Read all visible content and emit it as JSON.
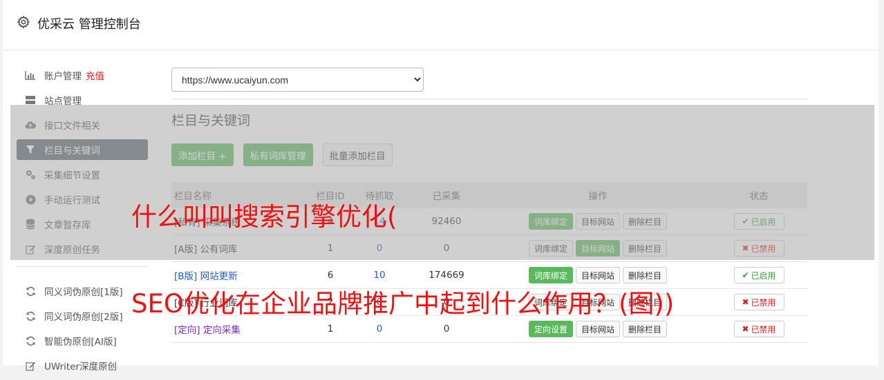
{
  "header": {
    "title": "优采云 管理控制台",
    "icon": "gear-icon"
  },
  "sidebar": {
    "items": [
      {
        "label": "账户管理",
        "extra": "充值",
        "icon": "bar-chart-icon"
      },
      {
        "label": "站点管理",
        "icon": "server-icon"
      },
      {
        "label": "接口文件相关",
        "icon": "cloud-upload-icon"
      },
      {
        "label": "栏目与关键词",
        "icon": "filter-icon",
        "active": true
      },
      {
        "label": "采集细节设置",
        "icon": "cogs-icon"
      },
      {
        "label": "手动运行测试",
        "icon": "play-circle-icon"
      },
      {
        "label": "文章暂存库",
        "icon": "database-icon"
      },
      {
        "label": "深度原创任务",
        "icon": "edit-icon"
      }
    ],
    "tools": [
      {
        "label": "同义词伪原创[1版]",
        "icon": "refresh-icon"
      },
      {
        "label": "同义词伪原创[2版]",
        "icon": "refresh-icon"
      },
      {
        "label": "智能伪原创[AI版]",
        "icon": "refresh-icon"
      },
      {
        "label": "UWriter深度原创",
        "icon": "edit-icon"
      }
    ]
  },
  "main": {
    "site_select": {
      "value": "https://www.ucaiyun.com"
    },
    "section_title": "栏目与关键词",
    "buttons": {
      "add_column": "添加栏目 +",
      "private_lib": "私有词库管理",
      "batch_add": "批量添加栏目"
    },
    "table": {
      "headers": {
        "name": "栏目名称",
        "id": "栏目ID",
        "wait": "待抓取",
        "done": "已采集",
        "ops": "操作",
        "status": "状态"
      },
      "op_labels": {
        "bind": "词库绑定",
        "target": "目标网站",
        "delete": "删除栏目",
        "direct": "定向设置"
      },
      "status_labels": {
        "on": "已启用",
        "off": "已禁用"
      },
      "rows": [
        {
          "name": "[私有] 采集系统",
          "id": "4",
          "wait": "14",
          "done": "92460",
          "status": "on"
        },
        {
          "name": "[A版] 公有词库",
          "id": "1",
          "wait": "0",
          "done": "0",
          "status": "off"
        },
        {
          "name": "[B版] 网站更新",
          "id": "6",
          "wait": "10",
          "done": "174669",
          "status": "on"
        },
        {
          "name": "[C版] 行业词库",
          "id": "2",
          "wait": "0",
          "done": "0",
          "status": "off"
        },
        {
          "name": "[定向] 定向采集",
          "id": "1",
          "wait": "0",
          "done": "0",
          "status": "off"
        }
      ]
    }
  },
  "watermarks": {
    "line1": "什么叫叫搜索引擎优化(",
    "line2": "SEO优化在企业品牌推广中起到什么作用？(图))"
  },
  "colors": {
    "accent_green": "#5cb85c",
    "active_nav": "#5a6470",
    "watermark_red": "#f01010",
    "link_blue": "#1e5cd6"
  }
}
